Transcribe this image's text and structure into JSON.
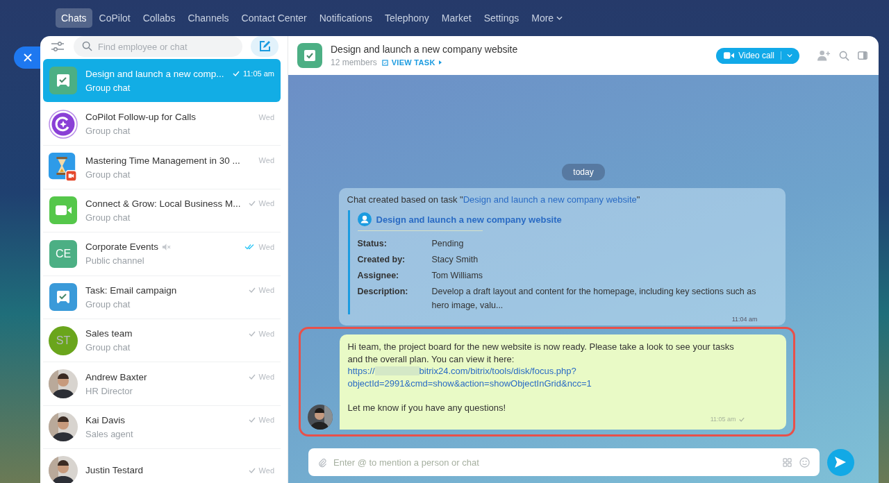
{
  "top_nav": [
    {
      "label": "Chats",
      "selected": true
    },
    {
      "label": "CoPilot",
      "selected": false
    },
    {
      "label": "Collabs",
      "selected": false
    },
    {
      "label": "Channels",
      "selected": false
    },
    {
      "label": "Contact Center",
      "selected": false
    },
    {
      "label": "Notifications",
      "selected": false
    },
    {
      "label": "Telephony",
      "selected": false
    },
    {
      "label": "Market",
      "selected": false
    },
    {
      "label": "Settings",
      "selected": false
    },
    {
      "label": "More",
      "selected": false,
      "dropdown": true
    }
  ],
  "sidebar": {
    "search": {
      "placeholder": "Find employee or chat"
    },
    "chats": [
      {
        "title": "Design and launch a new comp...",
        "subtitle": "Group chat",
        "time": "11:05 am",
        "selected": true,
        "read": true,
        "double_check": false,
        "muted": false,
        "avatar": {
          "kind": "task",
          "color": "#4caf84"
        }
      },
      {
        "title": "CoPilot Follow-up for Calls",
        "subtitle": "Group chat",
        "time": "Wed",
        "selected": false,
        "read": false,
        "muted": false,
        "avatar": {
          "kind": "copilot",
          "color": "#8a3fd6"
        }
      },
      {
        "title": "Mastering Time Management in 30 ...",
        "subtitle": "Group chat",
        "time": "Wed",
        "selected": false,
        "read": false,
        "muted": false,
        "avatar": {
          "kind": "hourglass",
          "color": "#2e9be8"
        }
      },
      {
        "title": "Connect & Grow: Local Business M...",
        "subtitle": "Group chat",
        "time": "Wed",
        "selected": false,
        "read": true,
        "double_check": false,
        "muted": false,
        "avatar": {
          "kind": "video",
          "color": "#55c74a"
        }
      },
      {
        "title": "Corporate Events",
        "subtitle": "Public channel",
        "time": "Wed",
        "selected": false,
        "read": true,
        "double_check": true,
        "muted": true,
        "avatar": {
          "kind": "initials",
          "initials": "CE",
          "color": "#4caf84"
        }
      },
      {
        "title": "Task: Email campaign",
        "subtitle": "Group chat",
        "time": "Wed",
        "selected": false,
        "read": true,
        "double_check": false,
        "muted": false,
        "avatar": {
          "kind": "task",
          "color": "#3a9ad9"
        }
      },
      {
        "title": "Sales team",
        "subtitle": "Group chat",
        "time": "Wed",
        "selected": false,
        "read": true,
        "double_check": false,
        "muted": false,
        "avatar": {
          "kind": "initials_round",
          "initials": "ST",
          "color": "#6aa51c"
        }
      },
      {
        "title": "Andrew Baxter",
        "subtitle": "HR Director",
        "time": "Wed",
        "selected": false,
        "read": true,
        "double_check": false,
        "muted": false
      },
      {
        "title": "Kai Davis",
        "subtitle": "Sales agent",
        "time": "Wed",
        "selected": false,
        "read": true,
        "double_check": false,
        "muted": false
      },
      {
        "title": "Justin Testard",
        "time": "Wed",
        "selected": false,
        "read": true,
        "double_check": false,
        "muted": false
      }
    ]
  },
  "chat": {
    "title": "Design and launch a new company website",
    "members": "12 members",
    "view_task": "VIEW TASK",
    "video_call": "Video call",
    "date": "today",
    "system_message": {
      "intro": "Chat created based on task \"",
      "task_link": "Design and launch a new company website",
      "outro": "\"",
      "card_title": "Design and launch a new company website",
      "fields": [
        {
          "label": "Status:",
          "value": "Pending"
        },
        {
          "label": "Created by:",
          "value": "Stacy Smith"
        },
        {
          "label": "Assignee:",
          "value": "Tom Williams"
        },
        {
          "label": "Description:",
          "value": "Develop a draft layout and content for the homepage, including key sections such as hero image, valu..."
        }
      ],
      "time": "11:04 am"
    },
    "message": {
      "text": "Hi team, the project board for the new website is now ready. Please take a look to see your tasks and the overall plan. You can view it here:",
      "link_prefix": "https://",
      "link_rest": "bitrix24.com/bitrix/tools/disk/focus.php?",
      "link_line2": "objectId=2991&cmd=show&action=showObjectInGrid&ncc=1",
      "closing": "Let me know if you have any questions!",
      "time": "11:05 am",
      "read": true,
      "highlighted": true
    },
    "input": {
      "placeholder": "Enter @ to mention a person or chat"
    }
  }
}
